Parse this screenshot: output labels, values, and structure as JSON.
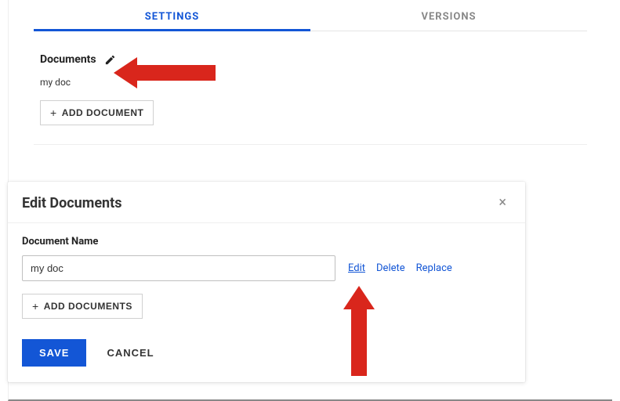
{
  "tabs": {
    "settings": "SETTINGS",
    "versions": "VERSIONS"
  },
  "documents": {
    "heading": "Documents",
    "items": [
      "my doc"
    ],
    "add_button": "ADD DOCUMENT"
  },
  "panel": {
    "title": "Edit Documents",
    "field_label": "Document Name",
    "input_value": "my doc",
    "actions": {
      "edit": "Edit",
      "delete": "Delete",
      "replace": "Replace"
    },
    "add_button": "ADD DOCUMENTS",
    "save": "SAVE",
    "cancel": "CANCEL"
  }
}
